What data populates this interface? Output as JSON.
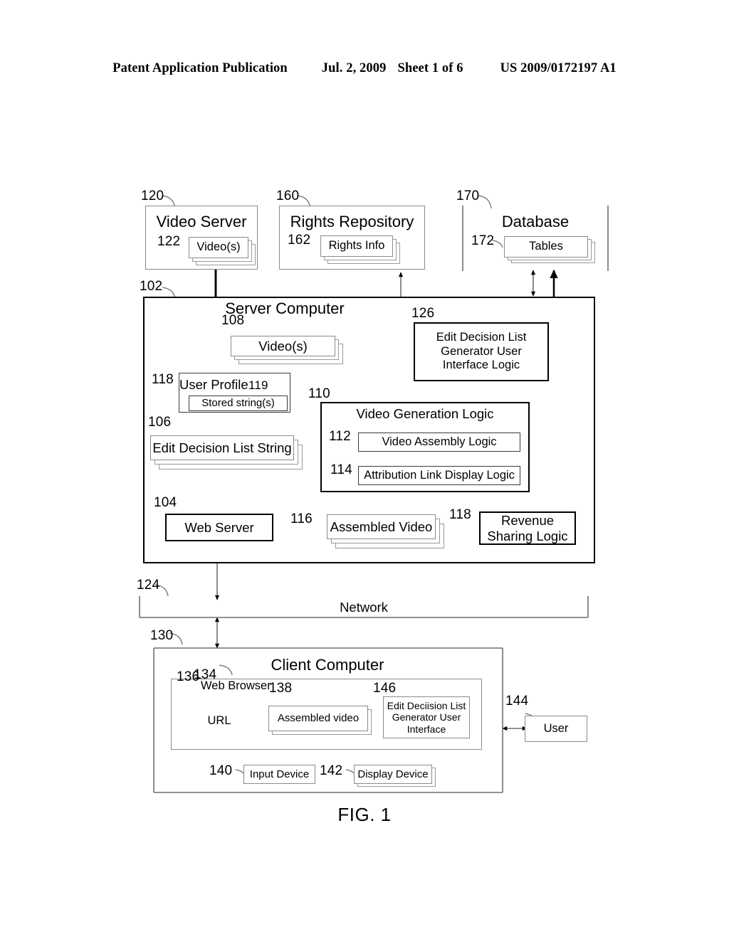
{
  "header": {
    "publication": "Patent Application Publication",
    "date": "Jul. 2, 2009",
    "sheet": "Sheet 1 of 6",
    "patent_number": "US 2009/0172197 A1"
  },
  "figure": {
    "caption": "FIG. 1",
    "nodes": {
      "video_server": {
        "ref": "120",
        "label": "Video Server"
      },
      "videos_source": {
        "ref": "122",
        "label": "Video(s)"
      },
      "rights_repository": {
        "ref": "160",
        "label": "Rights Repository"
      },
      "rights_info": {
        "ref": "162",
        "label": "Rights Info"
      },
      "database": {
        "ref": "170",
        "label": "Database"
      },
      "tables": {
        "ref": "172",
        "label": "Tables"
      },
      "server_computer": {
        "ref": "102",
        "label": "Server Computer"
      },
      "videos_local": {
        "ref": "108",
        "label": "Video(s)"
      },
      "edl_generator_ui_logic": {
        "ref": "126",
        "label": "Edit Decision List Generator User Interface Logic"
      },
      "user_profile": {
        "ref": "118",
        "label": "User Profile"
      },
      "stored_strings": {
        "ref": "119",
        "label": "Stored string(s)"
      },
      "edl_string": {
        "ref": "106",
        "label": "Edit Decision List String"
      },
      "video_generation_logic": {
        "ref": "110",
        "label": "Video Generation Logic"
      },
      "video_assembly_logic": {
        "ref": "112",
        "label": "Video Assembly Logic"
      },
      "attribution_link_logic": {
        "ref": "114",
        "label": "Attribution Link Display Logic"
      },
      "web_server": {
        "ref": "104",
        "label": "Web Server"
      },
      "assembled_video": {
        "ref": "116",
        "label": "Assembled Video"
      },
      "revenue_sharing_logic": {
        "ref": "118",
        "label": "Revenue Sharing Logic"
      },
      "network": {
        "ref": "124",
        "label": "Network"
      },
      "client_computer": {
        "ref": "130",
        "label": "Client Computer"
      },
      "web_browser": {
        "ref": "134",
        "label": "Web Browser"
      },
      "url": {
        "ref": "136",
        "label": "URL"
      },
      "assembled_video_client": {
        "ref": "138",
        "label": "Assembled video"
      },
      "edl_generator_ui": {
        "ref": "146",
        "label": "Edit Deciision List Generator User Interface"
      },
      "input_device": {
        "ref": "140",
        "label": "Input Device"
      },
      "display_device": {
        "ref": "142",
        "label": "Display Device"
      },
      "user": {
        "ref": "144",
        "label": "User"
      }
    }
  },
  "colors": {
    "ink": "#000000",
    "thin_line": "#8b8b8b",
    "medium_line": "#3a3a3a",
    "paper": "#ffffff"
  }
}
